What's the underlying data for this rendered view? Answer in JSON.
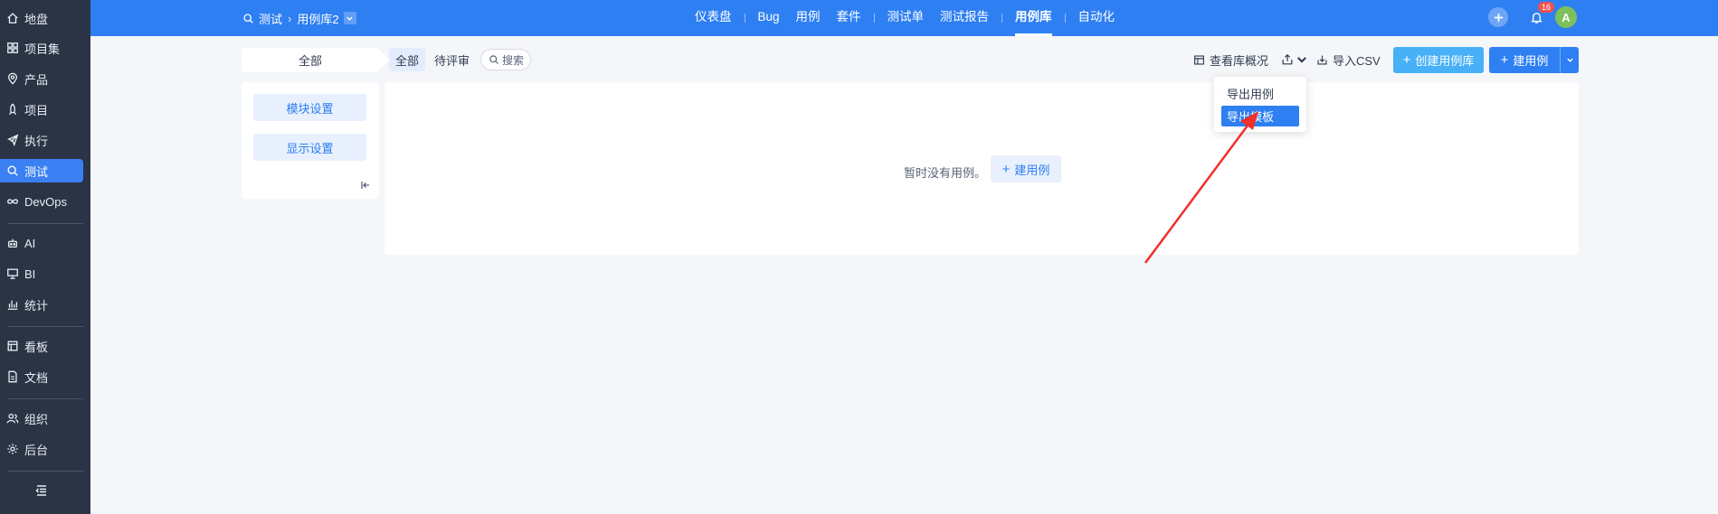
{
  "sidebar": {
    "items": [
      {
        "label": "地盘",
        "icon": "home-icon"
      },
      {
        "label": "项目集",
        "icon": "grid-icon"
      },
      {
        "label": "产品",
        "icon": "location-pin-icon"
      },
      {
        "label": "项目",
        "icon": "rocket-icon"
      },
      {
        "label": "执行",
        "icon": "launch-icon"
      },
      {
        "label": "测试",
        "icon": "search-icon",
        "active": true
      },
      {
        "label": "DevOps",
        "icon": "infinity-icon"
      },
      {
        "label": "AI",
        "icon": "robot-icon"
      },
      {
        "label": "BI",
        "icon": "presentation-icon"
      },
      {
        "label": "统计",
        "icon": "bar-chart-icon"
      },
      {
        "label": "看板",
        "icon": "kanban-icon"
      },
      {
        "label": "文档",
        "icon": "document-icon"
      },
      {
        "label": "组织",
        "icon": "people-icon"
      },
      {
        "label": "后台",
        "icon": "gear-icon"
      }
    ],
    "collapse_icon": "collapse-menu-icon"
  },
  "topbar": {
    "breadcrumb": {
      "module": "测试",
      "current": "用例库2"
    },
    "nav": [
      "仪表盘",
      "Bug",
      "用例",
      "套件",
      "测试单",
      "测试报告",
      "用例库",
      "自动化"
    ],
    "nav_active": "用例库",
    "notification_count": "16",
    "avatar_letter": "A"
  },
  "toolbar": {
    "scope": "全部",
    "tab_all": "全部",
    "tab_review": "待评审",
    "search": "搜索",
    "overview": "查看库概况",
    "import_csv": "导入CSV",
    "create_lib": "创建用例库",
    "create_case": "建用例"
  },
  "left_panel": {
    "module_settings": "模块设置",
    "display_settings": "显示设置"
  },
  "main": {
    "empty_text": "暂时没有用例。",
    "empty_button": "建用例"
  },
  "dropdown": {
    "items": [
      "导出用例",
      "导出模板"
    ],
    "highlighted": "导出模板"
  },
  "colors": {
    "primary": "#2e7ff2",
    "sidebar_bg": "#2b3444",
    "create_lib_btn": "#47b0f7",
    "annotation_arrow": "#f0302a"
  }
}
